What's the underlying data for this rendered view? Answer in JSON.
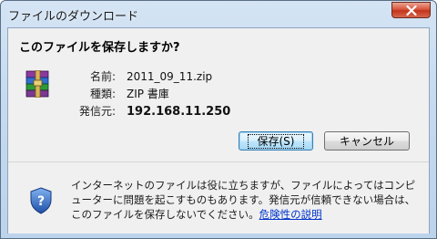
{
  "window": {
    "title": "ファイルのダウンロード"
  },
  "dialog": {
    "question": "このファイルを保存しますか?",
    "file_icon": "winrar-archive-icon",
    "fields": {
      "name_label": "名前:",
      "name_value": "2011_09_11.zip",
      "type_label": "種類:",
      "type_value": "ZIP 書庫",
      "from_label": "発信元:",
      "from_value": "192.168.11.250"
    },
    "buttons": {
      "save": "保存(S)",
      "cancel": "キャンセル"
    },
    "warning": {
      "icon": "security-shield-icon",
      "text": "インターネットのファイルは役に立ちますが、ファイルによってはコンピューターに問題を起こすものもあります。発信元が信頼できない場合は、このファイルを保存しないでください。",
      "link": "危険性の説明"
    }
  },
  "colors": {
    "title_bar": "#c6dbf0",
    "close_button": "#c2351c",
    "dialog_bg": "#f0f0f0",
    "link": "#0033cc"
  }
}
